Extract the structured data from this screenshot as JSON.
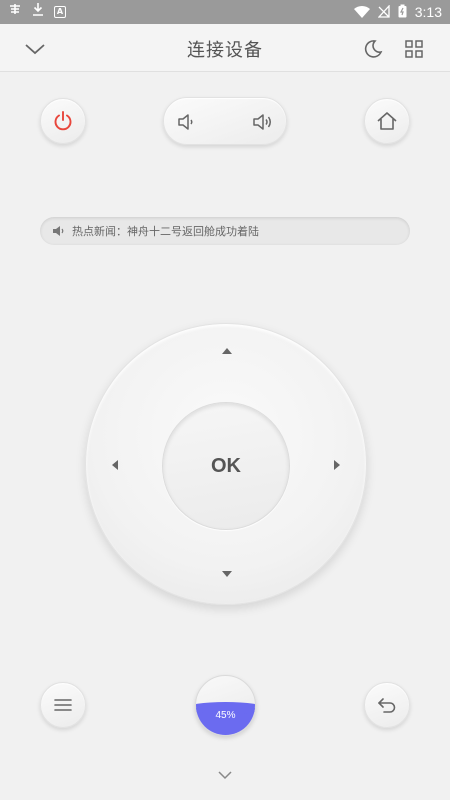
{
  "status_bar": {
    "time": "3:13",
    "left_icons": [
      "bug-icon",
      "download-icon",
      "a-box-icon"
    ],
    "right_icons": [
      "wifi-icon",
      "no-signal-icon",
      "battery-icon"
    ]
  },
  "header": {
    "title": "连接设备",
    "icons": [
      "chevron-down-icon",
      "moon-icon",
      "grid-icon"
    ]
  },
  "controls": {
    "power_icon": "power-icon",
    "volume_down_icon": "volume-down-icon",
    "volume_up_icon": "volume-up-icon",
    "home_icon": "home-icon"
  },
  "news": {
    "icon": "speaker-icon",
    "text": "热点新闻：神舟十二号返回舱成功着陆"
  },
  "dpad": {
    "ok_label": "OK"
  },
  "bottom": {
    "menu_icon": "menu-icon",
    "back_icon": "back-icon",
    "progress_label": "45%",
    "progress_value": 0.45
  },
  "colors": {
    "accent": "#6b6bf0",
    "power": "#e8463c",
    "status_bar": "#9a9a9a"
  }
}
